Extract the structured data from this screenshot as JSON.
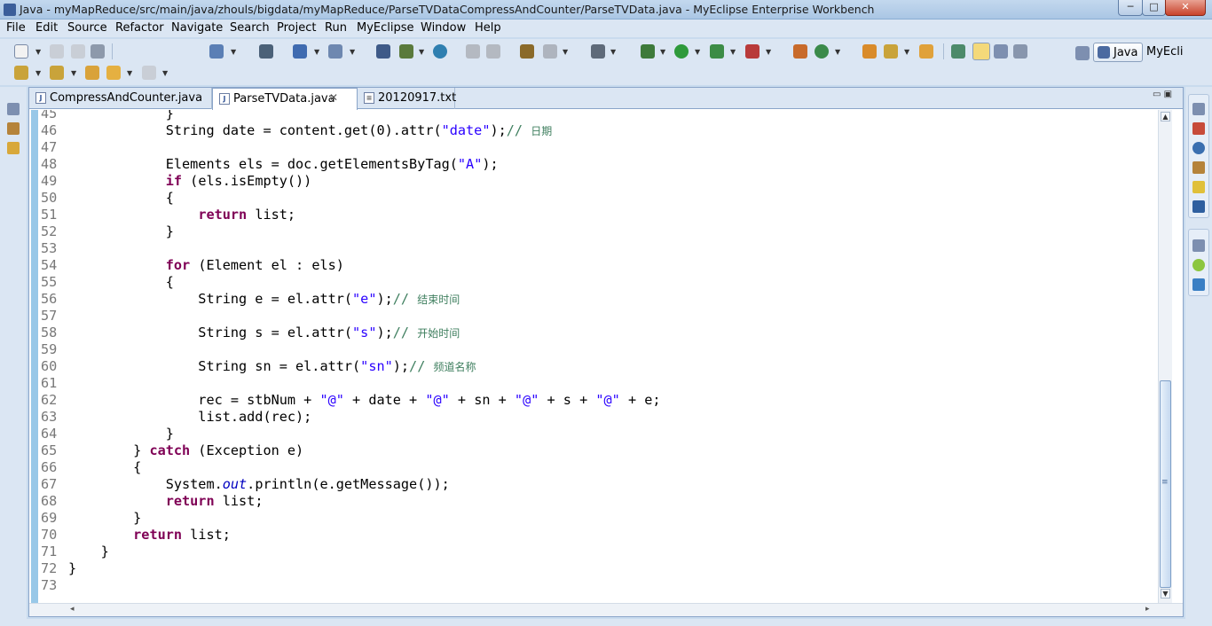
{
  "window": {
    "title": "Java - myMapReduce/src/main/java/zhouls/bigdata/myMapReduce/ParseTVDataCompressAndCounter/ParseTVData.java - MyEclipse Enterprise Workbench",
    "minimize_glyph": "─",
    "maximize_glyph": "□",
    "close_glyph": "✕"
  },
  "menu": [
    "File",
    "Edit",
    "Source",
    "Refactor",
    "Navigate",
    "Search",
    "Project",
    "Run",
    "MyEclipse",
    "Window",
    "Help"
  ],
  "perspectives": {
    "java_label": "Java",
    "myeclipse_label": "MyEcli"
  },
  "tabs": [
    {
      "label": "CompressAndCounter.java",
      "icon": "java-file-icon",
      "active": false
    },
    {
      "label": "ParseTVData.java",
      "icon": "java-file-icon",
      "active": true,
      "close": "✕"
    },
    {
      "label": "20120917.txt",
      "icon": "text-file-icon",
      "active": false
    }
  ],
  "editor": {
    "first_line": 45,
    "lines": [
      {
        "n": "45",
        "code": "            }"
      },
      {
        "n": "46",
        "code": "            String date = content.get(0).attr(\"date\");// 日期"
      },
      {
        "n": "47",
        "code": ""
      },
      {
        "n": "48",
        "code": "            Elements els = doc.getElementsByTag(\"A\");"
      },
      {
        "n": "49",
        "code": "            if (els.isEmpty())"
      },
      {
        "n": "50",
        "code": "            {"
      },
      {
        "n": "51",
        "code": "                return list;"
      },
      {
        "n": "52",
        "code": "            }"
      },
      {
        "n": "53",
        "code": ""
      },
      {
        "n": "54",
        "code": "            for (Element el : els)"
      },
      {
        "n": "55",
        "code": "            {"
      },
      {
        "n": "56",
        "code": "                String e = el.attr(\"e\");// 结束时间"
      },
      {
        "n": "57",
        "code": ""
      },
      {
        "n": "58",
        "code": "                String s = el.attr(\"s\");// 开始时间"
      },
      {
        "n": "59",
        "code": ""
      },
      {
        "n": "60",
        "code": "                String sn = el.attr(\"sn\");// 频道名称"
      },
      {
        "n": "61",
        "code": ""
      },
      {
        "n": "62",
        "code": "                rec = stbNum + \"@\" + date + \"@\" + sn + \"@\" + s + \"@\" + e;"
      },
      {
        "n": "63",
        "code": "                list.add(rec);"
      },
      {
        "n": "64",
        "code": "            }"
      },
      {
        "n": "65",
        "code": "        } catch (Exception e)"
      },
      {
        "n": "66",
        "code": "        {"
      },
      {
        "n": "67",
        "code": "            System.out.println(e.getMessage());"
      },
      {
        "n": "68",
        "code": "            return list;"
      },
      {
        "n": "69",
        "code": "        }"
      },
      {
        "n": "70",
        "code": "        return list;"
      },
      {
        "n": "71",
        "code": "    }"
      },
      {
        "n": "72",
        "code": "}"
      },
      {
        "n": "73",
        "code": ""
      }
    ]
  },
  "colors": {
    "keyword": "#7f0055",
    "string": "#2a00ff",
    "comment": "#3f7f5f",
    "static_field": "#0000c0",
    "line_number": "#787878",
    "change_bar": "#98c8e8"
  }
}
